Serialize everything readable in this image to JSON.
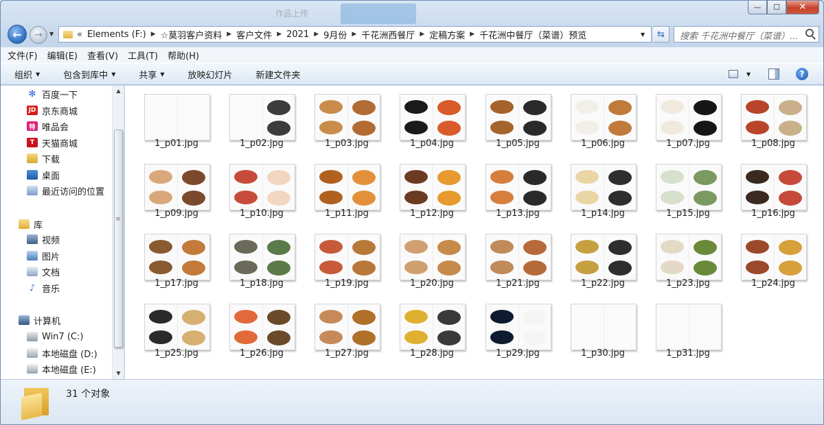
{
  "window": {
    "ghost_text": "作品上传",
    "buttons": {
      "minimize": "—",
      "maximize": "☐",
      "close": "✕"
    }
  },
  "address": {
    "lead": "«",
    "crumbs": [
      "Elements (F:)",
      "☆莫羽客户资料",
      "客户文件",
      "2021",
      "9月份",
      "千花洲西餐厅",
      "定稿方案",
      "千花洲中餐厅（菜谱）预览"
    ],
    "search_placeholder": "搜索 千花洲中餐厅（菜谱）..."
  },
  "menubar": [
    "文件(F)",
    "编辑(E)",
    "查看(V)",
    "工具(T)",
    "帮助(H)"
  ],
  "cmdbar": {
    "organize": "组织",
    "include": "包含到库中",
    "share": "共享",
    "slideshow": "放映幻灯片",
    "new_folder": "新建文件夹"
  },
  "sidebar": {
    "favorites": [
      "百度一下",
      "京东商城",
      "唯品会",
      "天猫商城",
      "下载",
      "桌面",
      "最近访问的位置"
    ],
    "library": "库",
    "library_items": [
      "视频",
      "图片",
      "文档",
      "音乐"
    ],
    "computer": "计算机",
    "drives": [
      "Win7 (C:)",
      "本地磁盘 (D:)",
      "本地磁盘 (E:)"
    ],
    "icon_text": {
      "jd": "JD",
      "vip": "特",
      "tmall": "T"
    }
  },
  "files": [
    "1_p01.jpg",
    "1_p02.jpg",
    "1_p03.jpg",
    "1_p04.jpg",
    "1_p05.jpg",
    "1_p06.jpg",
    "1_p07.jpg",
    "1_p08.jpg",
    "1_p09.jpg",
    "1_p10.jpg",
    "1_p11.jpg",
    "1_p12.jpg",
    "1_p13.jpg",
    "1_p14.jpg",
    "1_p15.jpg",
    "1_p16.jpg",
    "1_p17.jpg",
    "1_p18.jpg",
    "1_p19.jpg",
    "1_p20.jpg",
    "1_p21.jpg",
    "1_p22.jpg",
    "1_p23.jpg",
    "1_p24.jpg",
    "1_p25.jpg",
    "1_p26.jpg",
    "1_p27.jpg",
    "1_p28.jpg",
    "1_p29.jpg",
    "1_p30.jpg",
    "1_p31.jpg"
  ],
  "status": {
    "count_text": "31 个对象"
  }
}
